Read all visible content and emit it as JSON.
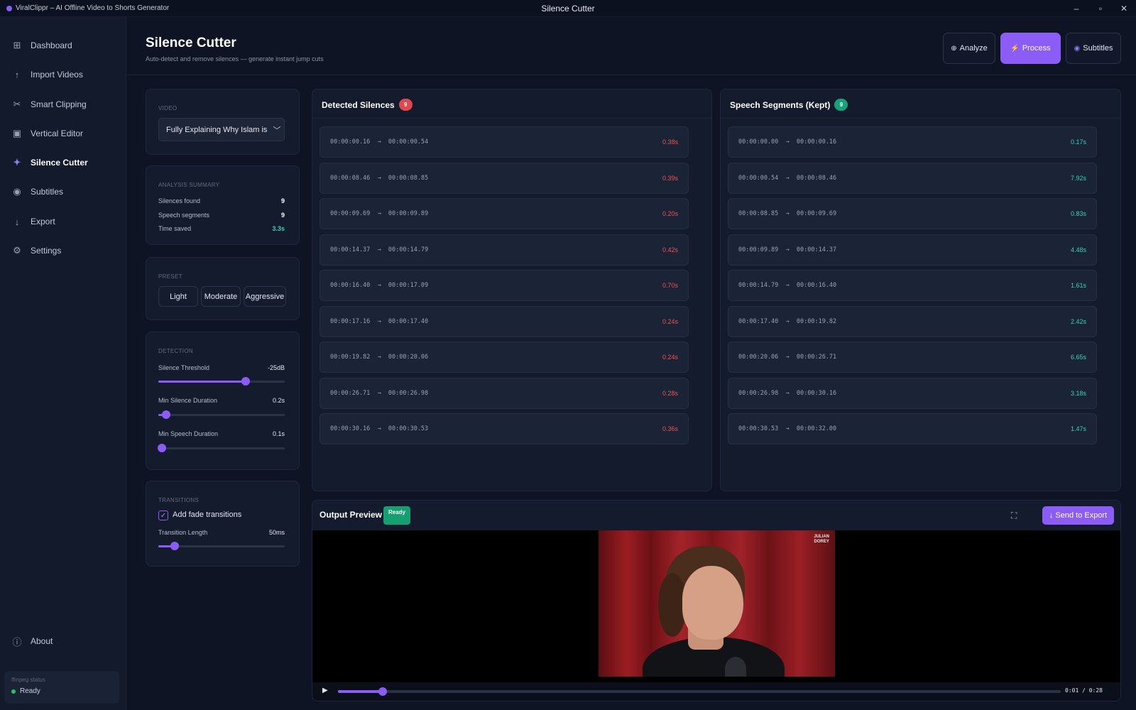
{
  "titlebar": {
    "app_title": "ViralClippr – AI Offline Video to Shorts Generator",
    "window_title": "Silence Cutter",
    "minimize": "–",
    "maximize": "▫",
    "close": "✕"
  },
  "sidebar": {
    "items": [
      {
        "label": "Dashboard",
        "icon": "grid-icon",
        "glyph": "⊞",
        "active": false
      },
      {
        "label": "Import Videos",
        "icon": "upload-icon",
        "glyph": "↑",
        "active": false
      },
      {
        "label": "Smart Clipping",
        "icon": "scissors-icon",
        "glyph": "✂",
        "active": false
      },
      {
        "label": "Vertical Editor",
        "icon": "phone-icon",
        "glyph": "▣",
        "active": false
      },
      {
        "label": "Silence Cutter",
        "icon": "sparkle-icon",
        "glyph": "✦",
        "active": true
      },
      {
        "label": "Subtitles",
        "icon": "subtitles-icon",
        "glyph": "◉",
        "active": false
      },
      {
        "label": "Export",
        "icon": "download-icon",
        "glyph": "↓",
        "active": false
      },
      {
        "label": "Settings",
        "icon": "gear-icon",
        "glyph": "⚙",
        "active": false
      }
    ],
    "about": {
      "label": "About",
      "icon": "info-icon",
      "glyph": "ⓘ"
    },
    "ffmpeg": {
      "label": "ffmpeg status",
      "status": "Ready"
    }
  },
  "header": {
    "title": "Silence Cutter",
    "subtitle": "Auto-detect and remove silences — generate instant jump cuts",
    "analyze_label": "Analyze",
    "process_label": "Process",
    "subtitles_label": "Subtitles"
  },
  "video_card": {
    "caption": "VIDEO",
    "selected": "Fully Explaining Why Islam is"
  },
  "analysis": {
    "caption": "ANALYSIS SUMMARY",
    "silences_label": "Silences found",
    "silences_value": "9",
    "segments_label": "Speech segments",
    "segments_value": "9",
    "saved_label": "Time saved",
    "saved_value": "3.3s"
  },
  "preset": {
    "caption": "PRESET",
    "options": [
      "Light",
      "Moderate",
      "Aggressive"
    ]
  },
  "detection": {
    "caption": "DETECTION",
    "threshold_label": "Silence Threshold",
    "threshold_value": "-25dB",
    "threshold_fraction": 0.69,
    "min_silence_label": "Min Silence Duration",
    "min_silence_value": "0.2s",
    "min_silence_fraction": 0.06,
    "min_speech_label": "Min Speech Duration",
    "min_speech_value": "0.1s",
    "min_speech_fraction": 0.03
  },
  "transitions": {
    "caption": "TRANSITIONS",
    "fade_label": "Add fade transitions",
    "fade_checked": true,
    "length_label": "Transition Length",
    "length_value": "50ms",
    "length_fraction": 0.13
  },
  "silences": {
    "title": "Detected Silences",
    "count": "9",
    "items": [
      {
        "range": "00:00:00.16  →  00:00:00.54",
        "dur": "0.38s"
      },
      {
        "range": "00:00:08.46  →  00:00:08.85",
        "dur": "0.39s"
      },
      {
        "range": "00:00:09.69  →  00:00:09.89",
        "dur": "0.20s"
      },
      {
        "range": "00:00:14.37  →  00:00:14.79",
        "dur": "0.42s"
      },
      {
        "range": "00:00:16.40  →  00:00:17.09",
        "dur": "0.70s"
      },
      {
        "range": "00:00:17.16  →  00:00:17.40",
        "dur": "0.24s"
      },
      {
        "range": "00:00:19.82  →  00:00:20.06",
        "dur": "0.24s"
      },
      {
        "range": "00:00:26.71  →  00:00:26.98",
        "dur": "0.28s"
      },
      {
        "range": "00:00:30.16  →  00:00:30.53",
        "dur": "0.36s"
      }
    ]
  },
  "segments": {
    "title": "Speech Segments (Kept)",
    "count": "9",
    "items": [
      {
        "range": "00:00:00.00  →  00:00:00.16",
        "dur": "0.17s"
      },
      {
        "range": "00:00:00.54  →  00:00:08.46",
        "dur": "7.92s"
      },
      {
        "range": "00:00:08.85  →  00:00:09.69",
        "dur": "0.83s"
      },
      {
        "range": "00:00:09.89  →  00:00:14.37",
        "dur": "4.48s"
      },
      {
        "range": "00:00:14.79  →  00:00:16.40",
        "dur": "1.61s"
      },
      {
        "range": "00:00:17.40  →  00:00:19.82",
        "dur": "2.42s"
      },
      {
        "range": "00:00:20.06  →  00:00:26.71",
        "dur": "6.65s"
      },
      {
        "range": "00:00:26.98  →  00:00:30.16",
        "dur": "3.18s"
      },
      {
        "range": "00:00:30.53  →  00:00:32.00",
        "dur": "1.47s"
      }
    ]
  },
  "preview": {
    "title": "Output Preview",
    "status": "Ready",
    "send_label": "↓ Send to Export",
    "watermark": "JULIAN DOREY",
    "time": "0:01 / 0:28",
    "progress_fraction": 0.062
  },
  "colors": {
    "accent": "#8b5cf6",
    "silence": "#ef5350",
    "speech": "#2dd4bf",
    "background": "#0f1424"
  }
}
